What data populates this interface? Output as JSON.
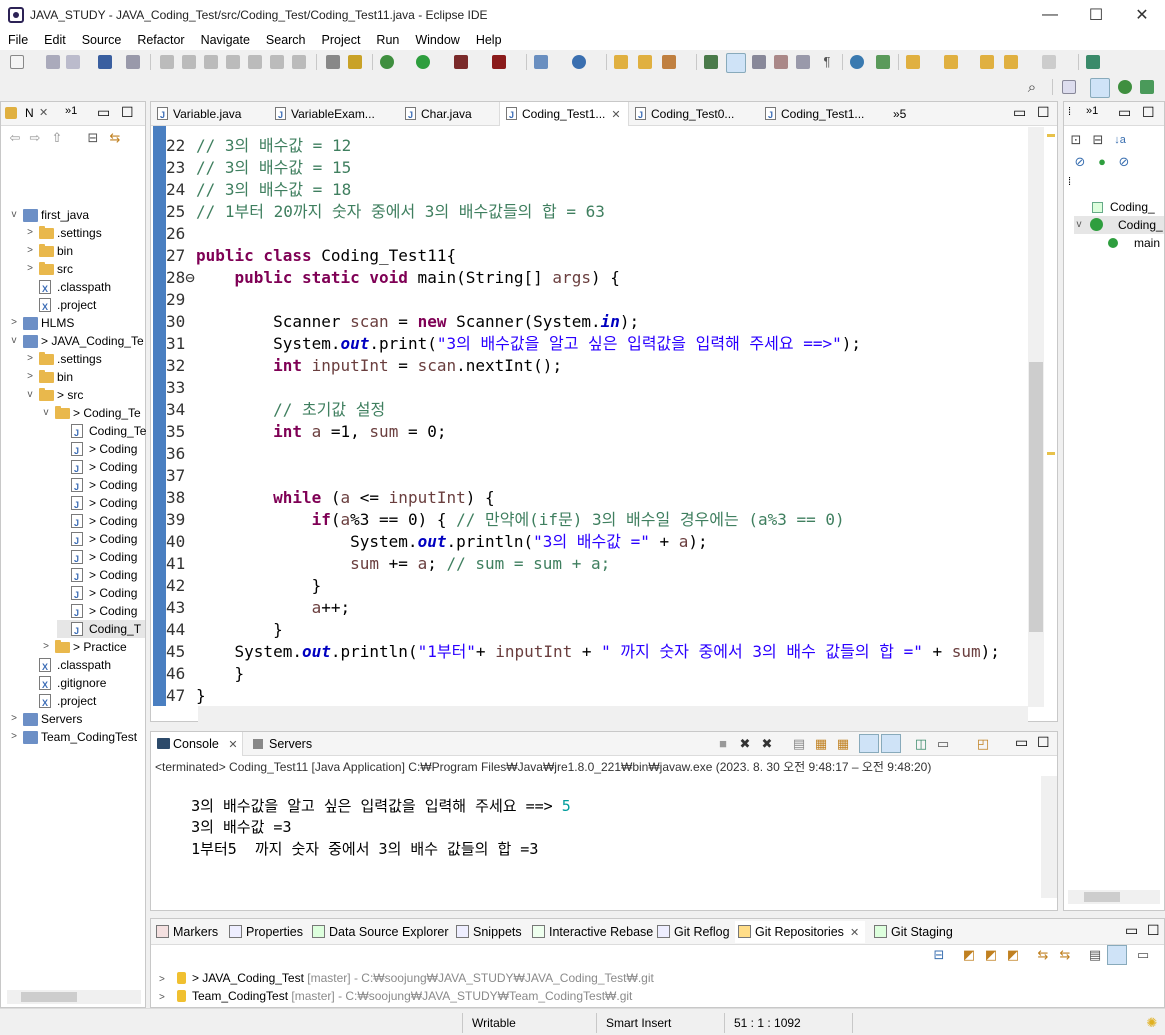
{
  "window": {
    "title": "JAVA_STUDY - JAVA_Coding_Test/src/Coding_Test/Coding_Test11.java - Eclipse IDE",
    "minimize": "—",
    "maximize": "☐",
    "close": "✕"
  },
  "menu": [
    "File",
    "Edit",
    "Source",
    "Refactor",
    "Navigate",
    "Search",
    "Project",
    "Run",
    "Window",
    "Help"
  ],
  "navigator": {
    "tab_label": "N",
    "tab_close": "✕",
    "tab_more": "»1",
    "tree": [
      {
        "label": "first_java",
        "indent": 0,
        "chev": "v",
        "icon": "proj"
      },
      {
        "label": ".settings",
        "indent": 1,
        "chev": ">",
        "icon": "folder"
      },
      {
        "label": "bin",
        "indent": 1,
        "chev": ">",
        "icon": "folder"
      },
      {
        "label": "src",
        "indent": 1,
        "chev": ">",
        "icon": "folder"
      },
      {
        "label": ".classpath",
        "indent": 1,
        "chev": "",
        "icon": "x"
      },
      {
        "label": ".project",
        "indent": 1,
        "chev": "",
        "icon": "x"
      },
      {
        "label": "HLMS",
        "indent": 0,
        "chev": ">",
        "icon": "proj"
      },
      {
        "label": "> JAVA_Coding_Te",
        "indent": 0,
        "chev": "v",
        "icon": "proj"
      },
      {
        "label": ".settings",
        "indent": 1,
        "chev": ">",
        "icon": "folder"
      },
      {
        "label": "bin",
        "indent": 1,
        "chev": ">",
        "icon": "folder"
      },
      {
        "label": "> src",
        "indent": 1,
        "chev": "v",
        "icon": "folder"
      },
      {
        "label": "> Coding_Te",
        "indent": 2,
        "chev": "v",
        "icon": "folder"
      },
      {
        "label": "Coding_Te",
        "indent": 3,
        "chev": "",
        "icon": "j"
      },
      {
        "label": "> Coding",
        "indent": 3,
        "chev": "",
        "icon": "j"
      },
      {
        "label": "> Coding",
        "indent": 3,
        "chev": "",
        "icon": "j"
      },
      {
        "label": "> Coding",
        "indent": 3,
        "chev": "",
        "icon": "j"
      },
      {
        "label": "> Coding",
        "indent": 3,
        "chev": "",
        "icon": "j"
      },
      {
        "label": "> Coding",
        "indent": 3,
        "chev": "",
        "icon": "j"
      },
      {
        "label": "> Coding",
        "indent": 3,
        "chev": "",
        "icon": "j"
      },
      {
        "label": "> Coding",
        "indent": 3,
        "chev": "",
        "icon": "j"
      },
      {
        "label": "> Coding",
        "indent": 3,
        "chev": "",
        "icon": "j"
      },
      {
        "label": "> Coding",
        "indent": 3,
        "chev": "",
        "icon": "j"
      },
      {
        "label": "> Coding",
        "indent": 3,
        "chev": "",
        "icon": "j"
      },
      {
        "label": "Coding_T",
        "indent": 3,
        "chev": "",
        "icon": "j"
      },
      {
        "label": "> Practice",
        "indent": 2,
        "chev": ">",
        "icon": "folder"
      },
      {
        "label": ".classpath",
        "indent": 1,
        "chev": "",
        "icon": "x"
      },
      {
        "label": ".gitignore",
        "indent": 1,
        "chev": "",
        "icon": "x"
      },
      {
        "label": ".project",
        "indent": 1,
        "chev": "",
        "icon": "x"
      },
      {
        "label": "Servers",
        "indent": 0,
        "chev": ">",
        "icon": "proj"
      },
      {
        "label": "Team_CodingTest",
        "indent": 0,
        "chev": ">",
        "icon": "proj"
      }
    ]
  },
  "editor_tabs": [
    {
      "label": "Variable.java"
    },
    {
      "label": "VariableExam..."
    },
    {
      "label": "Char.java"
    },
    {
      "label": "Coding_Test1...",
      "active": true,
      "close": "✕"
    },
    {
      "label": "Coding_Test0..."
    },
    {
      "label": "Coding_Test1..."
    },
    {
      "label": "»5"
    }
  ],
  "code_lines": [
    [
      {
        "t": "22 ",
        "c": "ln"
      },
      {
        "t": "// 3의 배수값 = 12",
        "c": "c"
      }
    ],
    [
      {
        "t": "23 ",
        "c": "ln"
      },
      {
        "t": "// 3의 배수값 = 15",
        "c": "c"
      }
    ],
    [
      {
        "t": "24 ",
        "c": "ln"
      },
      {
        "t": "// 3의 배수값 = 18",
        "c": "c"
      }
    ],
    [
      {
        "t": "25 ",
        "c": "ln"
      },
      {
        "t": "// 1부터 20까지 숫자 중에서 3의 배수값들의 합 = 63",
        "c": "c"
      }
    ],
    [
      {
        "t": "26 ",
        "c": "ln"
      }
    ],
    [
      {
        "t": "27 ",
        "c": "ln"
      },
      {
        "t": "public class",
        "c": "k"
      },
      {
        "t": " Coding_Test11{",
        "c": "t"
      }
    ],
    [
      {
        "t": "28⊖",
        "c": "ln"
      },
      {
        "t": "    ",
        "c": "t"
      },
      {
        "t": "public static void",
        "c": "k"
      },
      {
        "t": " main(String[] ",
        "c": "t"
      },
      {
        "t": "args",
        "c": "v"
      },
      {
        "t": ") {",
        "c": "t"
      }
    ],
    [
      {
        "t": "29 ",
        "c": "ln"
      }
    ],
    [
      {
        "t": "30 ",
        "c": "ln"
      },
      {
        "t": "        Scanner ",
        "c": "t"
      },
      {
        "t": "scan",
        "c": "v"
      },
      {
        "t": " = ",
        "c": "t"
      },
      {
        "t": "new",
        "c": "k"
      },
      {
        "t": " Scanner(System.",
        "c": "t"
      },
      {
        "t": "in",
        "c": "f"
      },
      {
        "t": ");",
        "c": "t"
      }
    ],
    [
      {
        "t": "31 ",
        "c": "ln"
      },
      {
        "t": "        System.",
        "c": "t"
      },
      {
        "t": "out",
        "c": "f"
      },
      {
        "t": ".print(",
        "c": "t"
      },
      {
        "t": "\"3의 배수값을 알고 싶은 입력값을 입력해 주세요 ==>\"",
        "c": "s"
      },
      {
        "t": ");",
        "c": "t"
      }
    ],
    [
      {
        "t": "32 ",
        "c": "ln"
      },
      {
        "t": "        ",
        "c": "t"
      },
      {
        "t": "int",
        "c": "k"
      },
      {
        "t": " ",
        "c": "t"
      },
      {
        "t": "inputInt",
        "c": "v"
      },
      {
        "t": " = ",
        "c": "t"
      },
      {
        "t": "scan",
        "c": "v"
      },
      {
        "t": ".nextInt();",
        "c": "t"
      }
    ],
    [
      {
        "t": "33 ",
        "c": "ln"
      }
    ],
    [
      {
        "t": "34 ",
        "c": "ln"
      },
      {
        "t": "        // 초기값 설정",
        "c": "c"
      }
    ],
    [
      {
        "t": "35 ",
        "c": "ln"
      },
      {
        "t": "        ",
        "c": "t"
      },
      {
        "t": "int",
        "c": "k"
      },
      {
        "t": " ",
        "c": "t"
      },
      {
        "t": "a",
        "c": "v"
      },
      {
        "t": " =1, ",
        "c": "t"
      },
      {
        "t": "sum",
        "c": "v"
      },
      {
        "t": " = 0;",
        "c": "t"
      }
    ],
    [
      {
        "t": "36 ",
        "c": "ln"
      }
    ],
    [
      {
        "t": "37 ",
        "c": "ln"
      }
    ],
    [
      {
        "t": "38 ",
        "c": "ln"
      },
      {
        "t": "        ",
        "c": "t"
      },
      {
        "t": "while",
        "c": "k"
      },
      {
        "t": " (",
        "c": "t"
      },
      {
        "t": "a",
        "c": "v"
      },
      {
        "t": " <= ",
        "c": "t"
      },
      {
        "t": "inputInt",
        "c": "v"
      },
      {
        "t": ") {",
        "c": "t"
      }
    ],
    [
      {
        "t": "39 ",
        "c": "ln"
      },
      {
        "t": "            ",
        "c": "t"
      },
      {
        "t": "if",
        "c": "k"
      },
      {
        "t": "(",
        "c": "t"
      },
      {
        "t": "a",
        "c": "v"
      },
      {
        "t": "%3 == 0) { ",
        "c": "t"
      },
      {
        "t": "// 만약에(if문) 3의 배수일 경우에는 (a%3 == 0)",
        "c": "c"
      }
    ],
    [
      {
        "t": "40 ",
        "c": "ln"
      },
      {
        "t": "                System.",
        "c": "t"
      },
      {
        "t": "out",
        "c": "f"
      },
      {
        "t": ".println(",
        "c": "t"
      },
      {
        "t": "\"3의 배수값 =\"",
        "c": "s"
      },
      {
        "t": " + ",
        "c": "t"
      },
      {
        "t": "a",
        "c": "v"
      },
      {
        "t": ");",
        "c": "t"
      }
    ],
    [
      {
        "t": "41 ",
        "c": "ln"
      },
      {
        "t": "                ",
        "c": "t"
      },
      {
        "t": "sum",
        "c": "v"
      },
      {
        "t": " += ",
        "c": "t"
      },
      {
        "t": "a",
        "c": "v"
      },
      {
        "t": "; ",
        "c": "t"
      },
      {
        "t": "// sum = sum + a;",
        "c": "c"
      }
    ],
    [
      {
        "t": "42 ",
        "c": "ln"
      },
      {
        "t": "            }",
        "c": "t"
      }
    ],
    [
      {
        "t": "43 ",
        "c": "ln"
      },
      {
        "t": "            ",
        "c": "t"
      },
      {
        "t": "a",
        "c": "v"
      },
      {
        "t": "++;",
        "c": "t"
      }
    ],
    [
      {
        "t": "44 ",
        "c": "ln"
      },
      {
        "t": "        }",
        "c": "t"
      }
    ],
    [
      {
        "t": "45 ",
        "c": "ln"
      },
      {
        "t": "    System.",
        "c": "t"
      },
      {
        "t": "out",
        "c": "f"
      },
      {
        "t": ".println(",
        "c": "t"
      },
      {
        "t": "\"1부터\"",
        "c": "s"
      },
      {
        "t": "+ ",
        "c": "t"
      },
      {
        "t": "inputInt",
        "c": "v"
      },
      {
        "t": " + ",
        "c": "t"
      },
      {
        "t": "\" 까지 숫자 중에서 3의 배수 값들의 합 =\"",
        "c": "s"
      },
      {
        "t": " + ",
        "c": "t"
      },
      {
        "t": "sum",
        "c": "v"
      },
      {
        "t": ");",
        "c": "t"
      }
    ],
    [
      {
        "t": "46 ",
        "c": "ln"
      },
      {
        "t": "    }",
        "c": "t"
      }
    ],
    [
      {
        "t": "47 ",
        "c": "ln"
      },
      {
        "t": "}",
        "c": "t"
      }
    ]
  ],
  "outline": {
    "tab_more": "»1",
    "items": [
      {
        "label": "Coding_"
      },
      {
        "label": "Coding_"
      },
      {
        "label": "main"
      }
    ]
  },
  "console": {
    "tabs": [
      {
        "label": "Console",
        "close": "✕"
      },
      {
        "label": "Servers"
      }
    ],
    "header": "<terminated> Coding_Test11 [Java Application] C:₩Program Files₩Java₩jre1.8.0_221₩bin₩javaw.exe  (2023. 8. 30 오전 9:48:17 – 오전 9:48:20)",
    "lines": [
      {
        "prompt": "3의 배수값을 알고 싶은 입력값을 입력해 주세요 ==> ",
        "input": "5"
      },
      {
        "prompt": "3의 배수값 =3",
        "input": ""
      },
      {
        "prompt": "1부터5  까지 숫자 중에서 3의 배수 값들의 합 =3",
        "input": ""
      }
    ]
  },
  "git_tabs": [
    {
      "label": "Markers"
    },
    {
      "label": "Properties"
    },
    {
      "label": "Data Source Explorer"
    },
    {
      "label": "Snippets"
    },
    {
      "label": "Interactive Rebase"
    },
    {
      "label": "Git Reflog"
    },
    {
      "label": "Git Repositories",
      "close": "✕"
    },
    {
      "label": "Git Staging"
    }
  ],
  "git_repos": [
    {
      "name": "> JAVA_Coding_Test",
      "branch": "[master]",
      "path": "- C:₩soojung₩JAVA_STUDY₩JAVA_Coding_Test₩.git"
    },
    {
      "name": "Team_CodingTest",
      "branch": "[master]",
      "path": "- C:₩soojung₩JAVA_STUDY₩Team_CodingTest₩.git"
    }
  ],
  "status": {
    "writable": "Writable",
    "insert_mode": "Smart Insert",
    "position": "51 : 1 : 1092"
  },
  "colors": {
    "comment": "#3f7f5f",
    "keyword": "#7f0055",
    "string": "#2a00ff",
    "field": "#0000c0",
    "console_input": "#009c9c"
  }
}
